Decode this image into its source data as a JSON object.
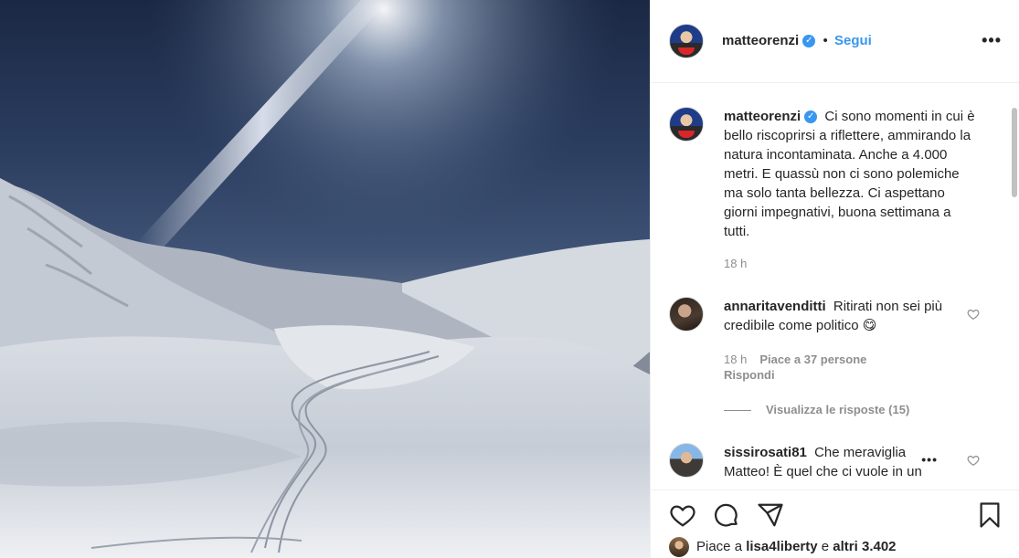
{
  "post": {
    "author": "matteorenzi",
    "separator": "•",
    "follow_label": "Segui",
    "more_icon": "more-options-icon",
    "caption": "Ci sono momenti in cui è bello riscoprirsi a riflettere, ammirando la natura incontaminata. Anche a 4.000 metri. E quassù non ci sono polemiche ma solo tanta bellezza. Ci aspettano giorni impegnativi, buona settimana a tutti.",
    "caption_time": "18 h"
  },
  "comments": [
    {
      "user": "annaritavenditti",
      "text": "Ritirati non sei più credibile come politico 😋",
      "time": "18 h",
      "likes": "Piace a 37 persone",
      "reply_label": "Rispondi",
      "view_replies": "Visualizza le risposte (15)"
    },
    {
      "user": "sissirosati81",
      "text": "Che meraviglia Matteo! È quel che ci vuole in un"
    }
  ],
  "actions": {
    "like_icon": "heart-icon",
    "comment_icon": "comment-icon",
    "share_icon": "share-icon",
    "save_icon": "bookmark-icon"
  },
  "likes": {
    "prefix": "Piace a",
    "user": "lisa4liberty",
    "connector": "e",
    "others": "altri 3.402"
  },
  "colors": {
    "accent": "#3897f0",
    "text": "#262626",
    "muted": "#8e8e8e",
    "border": "#efefef"
  }
}
